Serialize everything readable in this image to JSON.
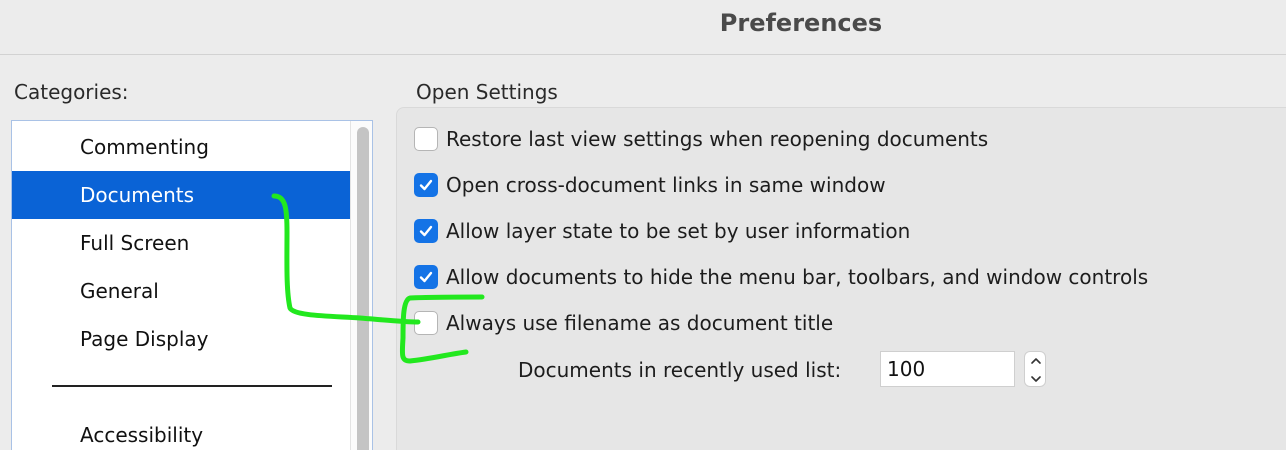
{
  "window": {
    "title": "Preferences"
  },
  "categories": {
    "label": "Categories:",
    "items": [
      {
        "label": "Commenting",
        "selected": false
      },
      {
        "label": "Documents",
        "selected": true
      },
      {
        "label": "Full Screen",
        "selected": false
      },
      {
        "label": "General",
        "selected": false
      },
      {
        "label": "Page Display",
        "selected": false
      }
    ],
    "secondary_items": [
      {
        "label": "Accessibility"
      }
    ]
  },
  "open_settings": {
    "title": "Open Settings",
    "options": [
      {
        "label": "Restore last view settings when reopening documents",
        "checked": false
      },
      {
        "label": "Open cross-document links in same window",
        "checked": true
      },
      {
        "label": "Allow layer state to be set by user information",
        "checked": true
      },
      {
        "label": "Allow documents to hide the menu bar, toolbars, and window controls",
        "checked": true
      },
      {
        "label": "Always use filename as document title",
        "checked": false
      }
    ],
    "recent_list": {
      "label": "Documents in recently used list:",
      "value": "100"
    }
  },
  "colors": {
    "selection": "#0a63d6",
    "checkbox_checked": "#1473e6",
    "annotation": "#22e81e"
  }
}
